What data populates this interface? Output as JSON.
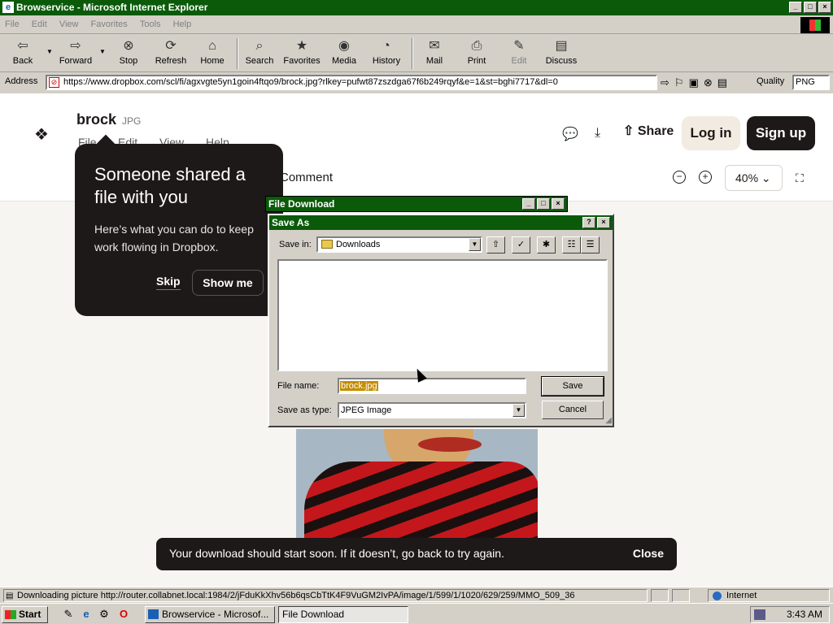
{
  "window": {
    "title": "Browservice - Microsoft Internet Explorer",
    "controls": [
      "_",
      "□",
      "×"
    ]
  },
  "menu": [
    "File",
    "Edit",
    "View",
    "Favorites",
    "Tools",
    "Help"
  ],
  "toolbar": {
    "back": "Back",
    "forward": "Forward",
    "stop": "Stop",
    "refresh": "Refresh",
    "home": "Home",
    "search": "Search",
    "favorites": "Favorites",
    "media": "Media",
    "history": "History",
    "mail": "Mail",
    "print": "Print",
    "edit": "Edit",
    "discuss": "Discuss"
  },
  "address": {
    "label": "Address",
    "url": "https://www.dropbox.com/scl/fi/agxvgte5yn1goin4ftqo9/brock.jpg?rlkey=pufwt87zszdga67f6b249rqyf&e=1&st=bghi7717&dl=0",
    "quality_label": "Quality",
    "quality_value": "PNG"
  },
  "dropbox": {
    "file_name": "brock",
    "file_ext": "JPG",
    "menu": [
      "File",
      "Edit",
      "View",
      "Help"
    ],
    "comment": "Comment",
    "share": "Share",
    "login": "Log in",
    "signup": "Sign up",
    "zoom": "40%"
  },
  "tour": {
    "title": "Someone shared a file with you",
    "body": "Here’s what you can do to keep work flowing in Dropbox.",
    "skip": "Skip",
    "show_me": "Show me"
  },
  "snackbar": {
    "text": "Your download should start soon. If it doesn’t, go back to try again.",
    "close": "Close"
  },
  "file_download": {
    "title": "File Download"
  },
  "save_as": {
    "title": "Save As",
    "save_in_label": "Save in:",
    "save_in_value": "Downloads",
    "file_name_label": "File name:",
    "file_name_value": "brock.jpg",
    "save_type_label": "Save as type:",
    "save_type_value": "JPEG Image",
    "save_button": "Save",
    "cancel_button": "Cancel"
  },
  "status": {
    "text": "Downloading picture http://router.collabnet.local:1984/2/jFduKkXhv56b6qsCbTtK4F9VuGM2IvPA/image/1/599/1/1020/629/259/MMO_509_36",
    "zone": "Internet"
  },
  "taskbar": {
    "start": "Start",
    "tasks": [
      "Browservice - Microsof...",
      "File Download"
    ],
    "clock": "3:43 AM"
  }
}
